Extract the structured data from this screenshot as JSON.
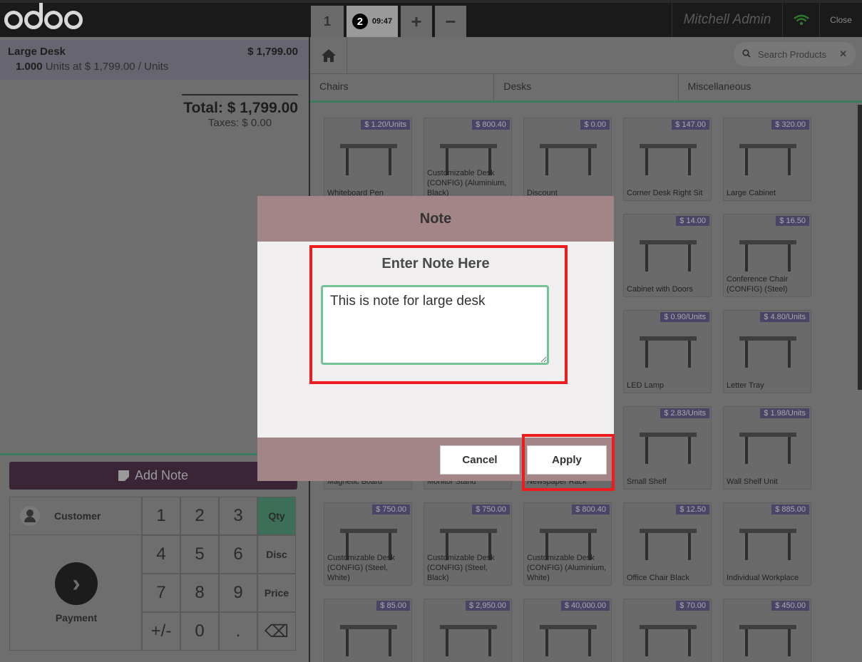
{
  "topbar": {
    "orders": [
      {
        "label": "1"
      },
      {
        "label": "2",
        "time": "09:47"
      }
    ],
    "add_label": "+",
    "remove_label": "−",
    "user": "Mitchell Admin",
    "close_label": "Close"
  },
  "order": {
    "line": {
      "product": "Large Desk",
      "price": "$ 1,799.00",
      "qty": "1.000",
      "unit_info": "Units at $ 1,799.00 / Units"
    },
    "total": "Total: $ 1,799.00",
    "taxes": "Taxes: $ 0.00"
  },
  "actions": {
    "add_note": "Add Note"
  },
  "numpad": {
    "customer": "Customer",
    "payment": "Payment",
    "keys": [
      "1",
      "2",
      "3",
      "Qty",
      "4",
      "5",
      "6",
      "Disc",
      "7",
      "8",
      "9",
      "Price",
      "+/-",
      "0",
      ".",
      "⌫"
    ]
  },
  "search": {
    "placeholder": "Search Products"
  },
  "categories": [
    "Chairs",
    "Desks",
    "Miscellaneous"
  ],
  "products": [
    {
      "name": "Whiteboard Pen",
      "price": "$ 1.20/Units"
    },
    {
      "name": "Customizable Desk (CONFIG) (Aluminium, Black)",
      "price": "$ 800.40"
    },
    {
      "name": "Discount",
      "price": "$ 0.00"
    },
    {
      "name": "Corner Desk Right Sit",
      "price": "$ 147.00"
    },
    {
      "name": "Large Cabinet",
      "price": "$ 320.00"
    },
    {
      "name": "Cabinet with Doors",
      "price": "$ 14.00"
    },
    {
      "name": "Conference Chair (CONFIG) (Steel)",
      "price": "$ 16.50"
    },
    {
      "name": "LED Lamp",
      "price": "$ 0.90/Units"
    },
    {
      "name": "Letter Tray",
      "price": "$ 4.80/Units"
    },
    {
      "name": "Magnetic Board",
      "price": ""
    },
    {
      "name": "Monitor Stand",
      "price": ""
    },
    {
      "name": "Newspaper Rack",
      "price": ""
    },
    {
      "name": "Small Shelf",
      "price": "$ 2.83/Units"
    },
    {
      "name": "Wall Shelf Unit",
      "price": "$ 1.98/Units"
    },
    {
      "name": "Customizable Desk (CONFIG) (Steel, White)",
      "price": "$ 750.00"
    },
    {
      "name": "Customizable Desk (CONFIG) (Steel, Black)",
      "price": "$ 750.00"
    },
    {
      "name": "Customizable Desk (CONFIG) (Aluminium, White)",
      "price": "$ 800.40"
    },
    {
      "name": "Office Chair Black",
      "price": "$ 12.50"
    },
    {
      "name": "Individual Workplace",
      "price": "$ 885.00"
    },
    {
      "name": "",
      "price": "$ 85.00"
    },
    {
      "name": "",
      "price": "$ 2,950.00"
    },
    {
      "name": "",
      "price": "$ 40,000.00"
    },
    {
      "name": "",
      "price": "$ 70.00"
    },
    {
      "name": "",
      "price": "$ 450.00"
    }
  ],
  "modal": {
    "title": "Note",
    "label": "Enter Note Here",
    "note_value": "This is note for large desk",
    "cancel_label": "Cancel",
    "apply_label": "Apply"
  }
}
